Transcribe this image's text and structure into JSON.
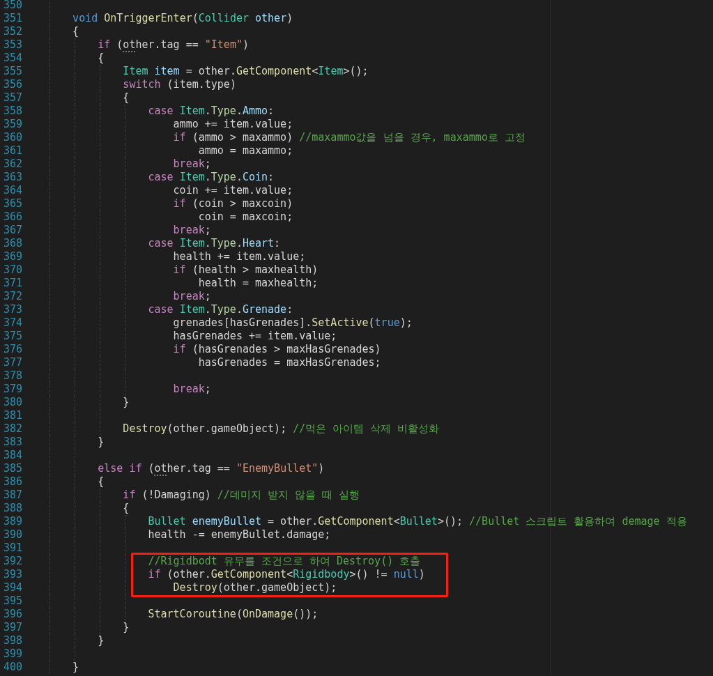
{
  "editor": {
    "lines": [
      {
        "number": "350",
        "highlighted": false
      },
      {
        "number": "351",
        "highlighted": false,
        "tokens": [
          {
            "kind": "keyword",
            "text": "    void "
          },
          {
            "kind": "function",
            "text": "OnTriggerEnter"
          },
          {
            "kind": "plain",
            "text": "("
          },
          {
            "kind": "type",
            "text": "Collider "
          },
          {
            "kind": "variable",
            "text": "other"
          },
          {
            "kind": "plain",
            "text": ")"
          }
        ]
      },
      {
        "number": "352",
        "highlighted": false,
        "tokens": [
          {
            "kind": "plain",
            "text": "    {"
          }
        ]
      },
      {
        "number": "353",
        "highlighted": false,
        "tokens": [
          {
            "kind": "control",
            "text": "        if"
          },
          {
            "kind": "plain",
            "text": " ("
          },
          {
            "kind": "hinted",
            "text": "ot"
          },
          {
            "kind": "plain",
            "text": "her.tag == "
          },
          {
            "kind": "string",
            "text": "\"Item\""
          },
          {
            "kind": "plain",
            "text": ")"
          }
        ]
      },
      {
        "number": "354",
        "highlighted": false,
        "tokens": [
          {
            "kind": "plain",
            "text": "        {"
          }
        ]
      },
      {
        "number": "355",
        "highlighted": false,
        "tokens": [
          {
            "kind": "type",
            "text": "            Item "
          },
          {
            "kind": "variable",
            "text": "item"
          },
          {
            "kind": "plain",
            "text": " = other."
          },
          {
            "kind": "function",
            "text": "GetComponent"
          },
          {
            "kind": "plain",
            "text": "<"
          },
          {
            "kind": "type",
            "text": "Item"
          },
          {
            "kind": "plain",
            "text": ">();"
          }
        ]
      },
      {
        "number": "356",
        "highlighted": false,
        "tokens": [
          {
            "kind": "control",
            "text": "            switch"
          },
          {
            "kind": "plain",
            "text": " (item.type)"
          }
        ]
      },
      {
        "number": "357",
        "highlighted": false,
        "tokens": [
          {
            "kind": "plain",
            "text": "            {"
          }
        ]
      },
      {
        "number": "358",
        "highlighted": false,
        "tokens": [
          {
            "kind": "control",
            "text": "                case "
          },
          {
            "kind": "type",
            "text": "Item"
          },
          {
            "kind": "plain",
            "text": "."
          },
          {
            "kind": "enum",
            "text": "Type"
          },
          {
            "kind": "plain",
            "text": "."
          },
          {
            "kind": "variable",
            "text": "Ammo"
          },
          {
            "kind": "plain",
            "text": ":"
          }
        ]
      },
      {
        "number": "359",
        "highlighted": false,
        "tokens": [
          {
            "kind": "plain",
            "text": "                    ammo += item.value;"
          }
        ]
      },
      {
        "number": "360",
        "highlighted": false,
        "tokens": [
          {
            "kind": "control",
            "text": "                    if"
          },
          {
            "kind": "plain",
            "text": " (ammo > maxammo) "
          },
          {
            "kind": "comment",
            "text": "//maxammo값을 넘을 경우, maxammo로 고정"
          }
        ]
      },
      {
        "number": "361",
        "highlighted": false,
        "tokens": [
          {
            "kind": "plain",
            "text": "                        ammo = maxammo;"
          }
        ]
      },
      {
        "number": "362",
        "highlighted": false,
        "tokens": [
          {
            "kind": "control",
            "text": "                    break"
          },
          {
            "kind": "plain",
            "text": ";"
          }
        ]
      },
      {
        "number": "363",
        "highlighted": false,
        "tokens": [
          {
            "kind": "control",
            "text": "                case "
          },
          {
            "kind": "type",
            "text": "Item"
          },
          {
            "kind": "plain",
            "text": "."
          },
          {
            "kind": "enum",
            "text": "Type"
          },
          {
            "kind": "plain",
            "text": "."
          },
          {
            "kind": "variable",
            "text": "Coin"
          },
          {
            "kind": "plain",
            "text": ":"
          }
        ]
      },
      {
        "number": "364",
        "highlighted": false,
        "tokens": [
          {
            "kind": "plain",
            "text": "                    coin += item.value;"
          }
        ]
      },
      {
        "number": "365",
        "highlighted": false,
        "tokens": [
          {
            "kind": "control",
            "text": "                    if"
          },
          {
            "kind": "plain",
            "text": " (coin > maxcoin)"
          }
        ]
      },
      {
        "number": "366",
        "highlighted": false,
        "tokens": [
          {
            "kind": "plain",
            "text": "                        coin = maxcoin;"
          }
        ]
      },
      {
        "number": "367",
        "highlighted": false,
        "tokens": [
          {
            "kind": "control",
            "text": "                    break"
          },
          {
            "kind": "plain",
            "text": ";"
          }
        ]
      },
      {
        "number": "368",
        "highlighted": false,
        "tokens": [
          {
            "kind": "control",
            "text": "                case "
          },
          {
            "kind": "type",
            "text": "Item"
          },
          {
            "kind": "plain",
            "text": "."
          },
          {
            "kind": "enum",
            "text": "Type"
          },
          {
            "kind": "plain",
            "text": "."
          },
          {
            "kind": "variable",
            "text": "Heart"
          },
          {
            "kind": "plain",
            "text": ":"
          }
        ]
      },
      {
        "number": "369",
        "highlighted": false,
        "tokens": [
          {
            "kind": "plain",
            "text": "                    health += item.value;"
          }
        ]
      },
      {
        "number": "370",
        "highlighted": false,
        "tokens": [
          {
            "kind": "control",
            "text": "                    if"
          },
          {
            "kind": "plain",
            "text": " (health > maxhealth)"
          }
        ]
      },
      {
        "number": "371",
        "highlighted": false,
        "tokens": [
          {
            "kind": "plain",
            "text": "                        health = maxhealth;"
          }
        ]
      },
      {
        "number": "372",
        "highlighted": false,
        "tokens": [
          {
            "kind": "control",
            "text": "                    break"
          },
          {
            "kind": "plain",
            "text": ";"
          }
        ]
      },
      {
        "number": "373",
        "highlighted": false,
        "tokens": [
          {
            "kind": "control",
            "text": "                case "
          },
          {
            "kind": "type",
            "text": "Item"
          },
          {
            "kind": "plain",
            "text": "."
          },
          {
            "kind": "enum",
            "text": "Type"
          },
          {
            "kind": "plain",
            "text": "."
          },
          {
            "kind": "variable",
            "text": "Grenade"
          },
          {
            "kind": "plain",
            "text": ":"
          }
        ]
      },
      {
        "number": "374",
        "highlighted": false,
        "tokens": [
          {
            "kind": "plain",
            "text": "                    grenades[hasGrenades]."
          },
          {
            "kind": "function",
            "text": "SetActive"
          },
          {
            "kind": "plain",
            "text": "("
          },
          {
            "kind": "keyword",
            "text": "true"
          },
          {
            "kind": "plain",
            "text": ");"
          }
        ]
      },
      {
        "number": "375",
        "highlighted": false,
        "tokens": [
          {
            "kind": "plain",
            "text": "                    hasGrenades += item.value;"
          }
        ]
      },
      {
        "number": "376",
        "highlighted": false,
        "tokens": [
          {
            "kind": "control",
            "text": "                    if"
          },
          {
            "kind": "plain",
            "text": " (hasGrenades > maxHasGrenades)"
          }
        ]
      },
      {
        "number": "377",
        "highlighted": false,
        "tokens": [
          {
            "kind": "plain",
            "text": "                        hasGrenades = maxHasGrenades;"
          }
        ]
      },
      {
        "number": "378",
        "highlighted": false
      },
      {
        "number": "379",
        "highlighted": false,
        "tokens": [
          {
            "kind": "control",
            "text": "                    break"
          },
          {
            "kind": "plain",
            "text": ";"
          }
        ]
      },
      {
        "number": "380",
        "highlighted": false,
        "tokens": [
          {
            "kind": "plain",
            "text": "            }"
          }
        ]
      },
      {
        "number": "381",
        "highlighted": false
      },
      {
        "number": "382",
        "highlighted": false,
        "tokens": [
          {
            "kind": "function",
            "text": "            Destroy"
          },
          {
            "kind": "plain",
            "text": "(other.gameObject); "
          },
          {
            "kind": "comment",
            "text": "//먹은 아이템 삭제 비활성화"
          }
        ]
      },
      {
        "number": "383",
        "highlighted": false,
        "tokens": [
          {
            "kind": "plain",
            "text": "        }"
          }
        ]
      },
      {
        "number": "384",
        "highlighted": false
      },
      {
        "number": "385",
        "highlighted": false,
        "tokens": [
          {
            "kind": "control",
            "text": "        else if"
          },
          {
            "kind": "plain",
            "text": " ("
          },
          {
            "kind": "hinted",
            "text": "ot"
          },
          {
            "kind": "plain",
            "text": "her.tag == "
          },
          {
            "kind": "string",
            "text": "\"EnemyBullet\""
          },
          {
            "kind": "plain",
            "text": ")"
          }
        ]
      },
      {
        "number": "386",
        "highlighted": false,
        "tokens": [
          {
            "kind": "plain",
            "text": "        {"
          }
        ]
      },
      {
        "number": "387",
        "highlighted": false,
        "tokens": [
          {
            "kind": "control",
            "text": "            if"
          },
          {
            "kind": "plain",
            "text": " (!Damaging) "
          },
          {
            "kind": "comment",
            "text": "//데미지 받지 않을 때 실행"
          }
        ]
      },
      {
        "number": "388",
        "highlighted": false,
        "tokens": [
          {
            "kind": "plain",
            "text": "            {"
          }
        ]
      },
      {
        "number": "389",
        "highlighted": false,
        "tokens": [
          {
            "kind": "type",
            "text": "                Bullet "
          },
          {
            "kind": "variable",
            "text": "enemyBullet"
          },
          {
            "kind": "plain",
            "text": " = other."
          },
          {
            "kind": "function",
            "text": "GetComponent"
          },
          {
            "kind": "plain",
            "text": "<"
          },
          {
            "kind": "type",
            "text": "Bullet"
          },
          {
            "kind": "plain",
            "text": ">(); "
          },
          {
            "kind": "comment",
            "text": "//Bullet 스크립트 활용하여 demage 적용"
          }
        ]
      },
      {
        "number": "390",
        "highlighted": false,
        "tokens": [
          {
            "kind": "plain",
            "text": "                health -= enemyBullet.damage;"
          }
        ]
      },
      {
        "number": "391",
        "highlighted": false
      },
      {
        "number": "392",
        "highlighted": true,
        "tokens": [
          {
            "kind": "comment",
            "text": "                //Rigidbodt 유무를 조건으로 하여 Destroy() 호출"
          }
        ]
      },
      {
        "number": "393",
        "highlighted": true,
        "tokens": [
          {
            "kind": "control",
            "text": "                if"
          },
          {
            "kind": "plain",
            "text": " (other."
          },
          {
            "kind": "function",
            "text": "GetComponent"
          },
          {
            "kind": "plain",
            "text": "<"
          },
          {
            "kind": "type",
            "text": "Rigidbody"
          },
          {
            "kind": "plain",
            "text": ">() != "
          },
          {
            "kind": "keyword",
            "text": "null"
          },
          {
            "kind": "plain",
            "text": ")"
          }
        ]
      },
      {
        "number": "394",
        "highlighted": true,
        "tokens": [
          {
            "kind": "function",
            "text": "                    Destroy"
          },
          {
            "kind": "plain",
            "text": "(other.gameObject);"
          }
        ]
      },
      {
        "number": "395",
        "highlighted": false
      },
      {
        "number": "396",
        "highlighted": false,
        "tokens": [
          {
            "kind": "function",
            "text": "                StartCoroutine"
          },
          {
            "kind": "plain",
            "text": "("
          },
          {
            "kind": "function",
            "text": "OnDamage"
          },
          {
            "kind": "plain",
            "text": "());"
          }
        ]
      },
      {
        "number": "397",
        "highlighted": false,
        "tokens": [
          {
            "kind": "plain",
            "text": "            }"
          }
        ]
      },
      {
        "number": "398",
        "highlighted": false,
        "tokens": [
          {
            "kind": "plain",
            "text": "        }"
          }
        ]
      },
      {
        "number": "399",
        "highlighted": false
      },
      {
        "number": "400",
        "highlighted": false,
        "tokens": [
          {
            "kind": "plain",
            "text": "    }"
          }
        ]
      }
    ]
  }
}
